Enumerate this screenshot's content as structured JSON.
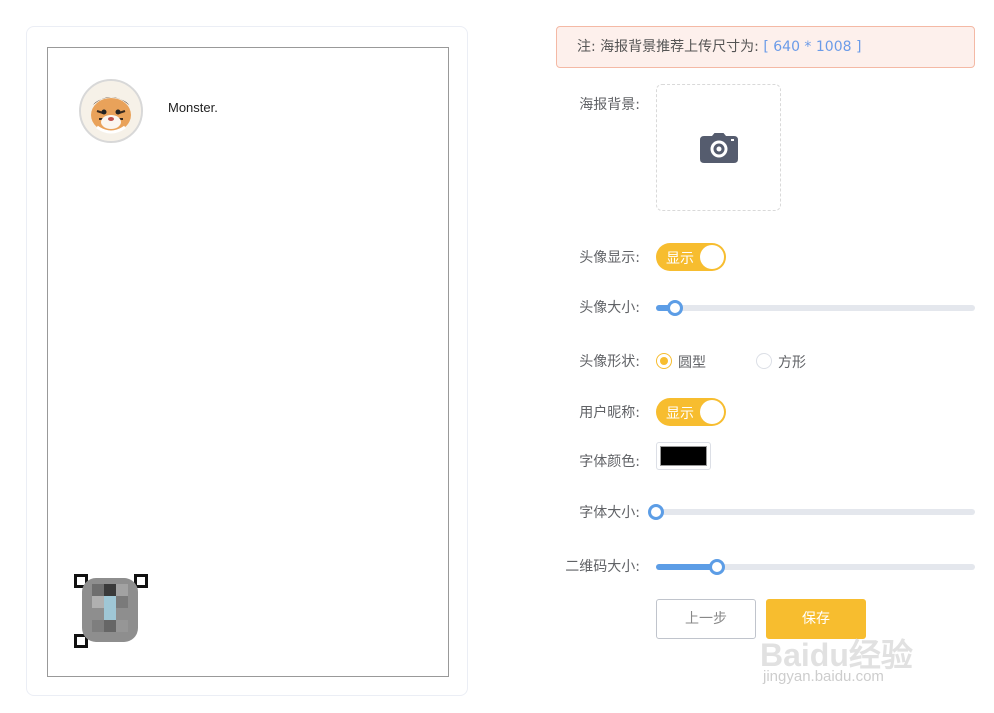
{
  "poster": {
    "nickname": "Monster."
  },
  "notice": {
    "prefix": "注: 海报背景推荐上传尺寸为: ",
    "size": "[ 640 * 1008 ]"
  },
  "form": {
    "background_label": "海报背景:",
    "avatar_show_label": "头像显示:",
    "avatar_show_switch_text": "显示",
    "avatar_size_label": "头像大小:",
    "avatar_size_value": 0.06,
    "avatar_shape_label": "头像形状:",
    "avatar_shape_options": [
      "圆型",
      "方形"
    ],
    "avatar_shape_selected": "圆型",
    "nickname_label": "用户昵称:",
    "nickname_switch_text": "显示",
    "font_color_label": "字体颜色:",
    "font_color_value": "#000000",
    "font_size_label": "字体大小:",
    "font_size_value": 0.0,
    "qrcode_size_label": "二维码大小:",
    "qrcode_size_value": 0.19
  },
  "buttons": {
    "prev_label": "上一步",
    "save_label": "保存"
  },
  "watermark": {
    "main": "Baidu经验",
    "sub": "jingyan.baidu.com"
  },
  "colors": {
    "accent": "#f7bd2f",
    "slider": "#5c9de6",
    "notice_bg": "#fdf0ec"
  }
}
